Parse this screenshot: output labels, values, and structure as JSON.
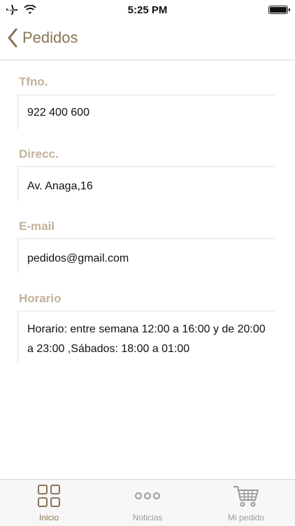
{
  "status_bar": {
    "time": "5:25 PM"
  },
  "nav": {
    "back_label": "Pedidos"
  },
  "fields": [
    {
      "label": "Tfno.",
      "value": "922 400 600"
    },
    {
      "label": "Direcc.",
      "value": "Av. Anaga,16"
    },
    {
      "label": "E-mail",
      "value": "pedidos@gmail.com"
    },
    {
      "label": "Horario",
      "value": "Horario: entre semana 12:00 a 16:00 y de 20:00 a 23:00 ,Sábados: 18:00 a 01:00"
    }
  ],
  "tabs": [
    {
      "label": "Inicio",
      "icon": "grid-icon",
      "active": true
    },
    {
      "label": "Noticias",
      "icon": "more-icon",
      "active": false
    },
    {
      "label": "Mi pedido",
      "icon": "cart-icon",
      "active": false
    }
  ],
  "colors": {
    "accent": "#8a7553",
    "label": "#c2b29a",
    "inactive": "#9a9a9a"
  }
}
